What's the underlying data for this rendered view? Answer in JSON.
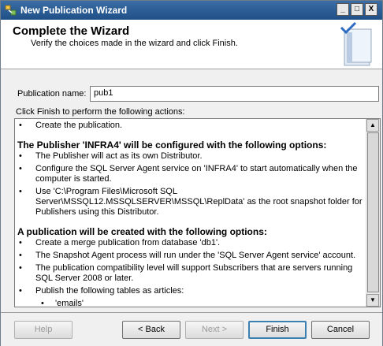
{
  "window": {
    "title": "New Publication Wizard"
  },
  "title_buttons": {
    "minimize": "_",
    "maximize": "□",
    "close": "X"
  },
  "header": {
    "title": "Complete the Wizard",
    "subtitle": "Verify the choices made in the wizard and click Finish."
  },
  "publication": {
    "label": "Publication name:",
    "value": "pub1"
  },
  "instructions": "Click Finish to perform the following actions:",
  "actions": {
    "item1": "Create the publication.",
    "heading1": "The Publisher 'INFRA4' will be configured with the following options:",
    "pub_items": [
      "The Publisher will act as its own Distributor.",
      "Configure the SQL Server Agent service on 'INFRA4' to start automatically when the computer is started.",
      "Use 'C:\\Program Files\\Microsoft SQL Server\\MSSQL12.MSSQLSERVER\\MSSQL\\ReplData' as the root snapshot folder for Publishers using this Distributor."
    ],
    "heading2": "A publication will be created with the following options:",
    "pub2_items": [
      "Create a merge publication from database 'db1'.",
      "The Snapshot Agent process will run under the 'SQL Server Agent service' account.",
      "The publication compatibility level will support Subscribers that are servers running SQL Server 2008 or later.",
      "Publish the following tables as articles:"
    ],
    "articles": [
      "'emails'"
    ]
  },
  "buttons": {
    "help": "Help",
    "back": "< Back",
    "next": "Next >",
    "finish": "Finish",
    "cancel": "Cancel"
  }
}
